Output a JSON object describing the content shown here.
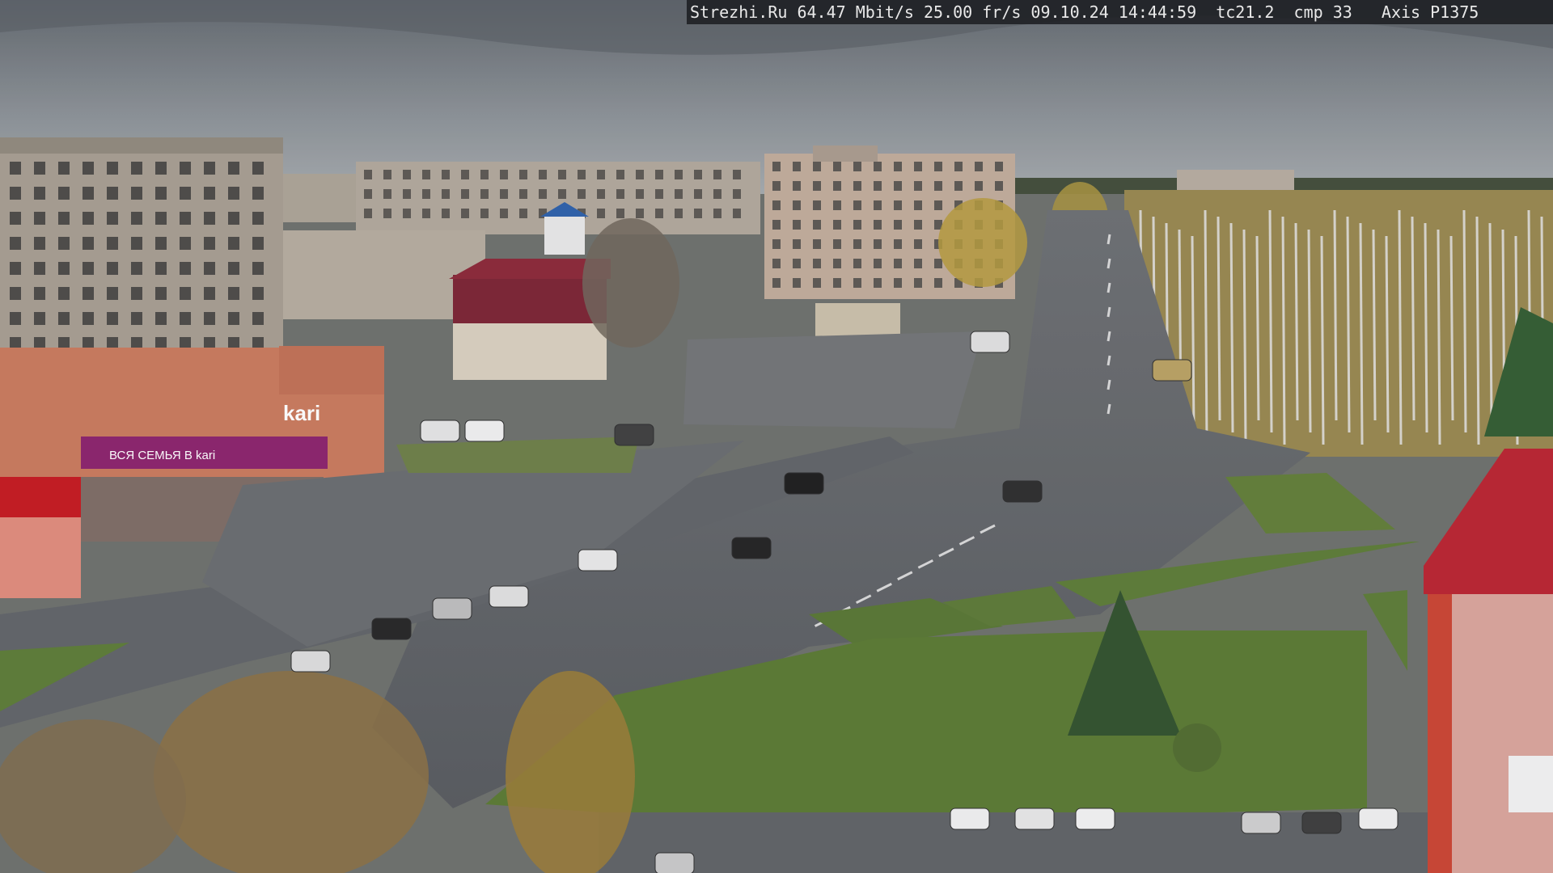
{
  "camera": {
    "overlay_text": "Strezhi.Ru 64.47 Mbit/s 25.00 fr/s 09.10.24 14:44:59  tc21.2  cmp 33   Axis P1375"
  },
  "signs": {
    "store_logo": "kari",
    "store_banner": "ВСЯ СЕМЬЯ В kari"
  },
  "colors": {
    "sky": "#7b8186",
    "road": "#5b5e62",
    "grass": "#5d7a34",
    "brand": "#8a1f6a"
  }
}
